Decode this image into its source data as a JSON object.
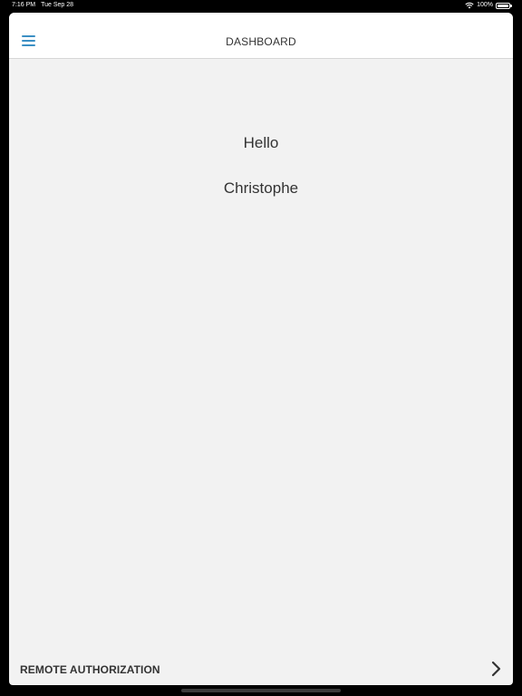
{
  "status_bar": {
    "time": "7:16 PM",
    "date": "Tue Sep 28",
    "battery": "100%",
    "wifi_icon": "wifi-icon",
    "battery_icon": "battery-icon"
  },
  "nav": {
    "title": "DASHBOARD",
    "menu_icon": "hamburger-menu-icon",
    "accent_color": "#3b8fc4"
  },
  "main": {
    "greeting": "Hello",
    "user_name": "Christophe"
  },
  "footer": {
    "label": "REMOTE AUTHORIZATION",
    "icon": "chevron-right-icon"
  },
  "colors": {
    "background": "#f2f2f2",
    "nav_background": "#ffffff",
    "text": "#333333"
  }
}
